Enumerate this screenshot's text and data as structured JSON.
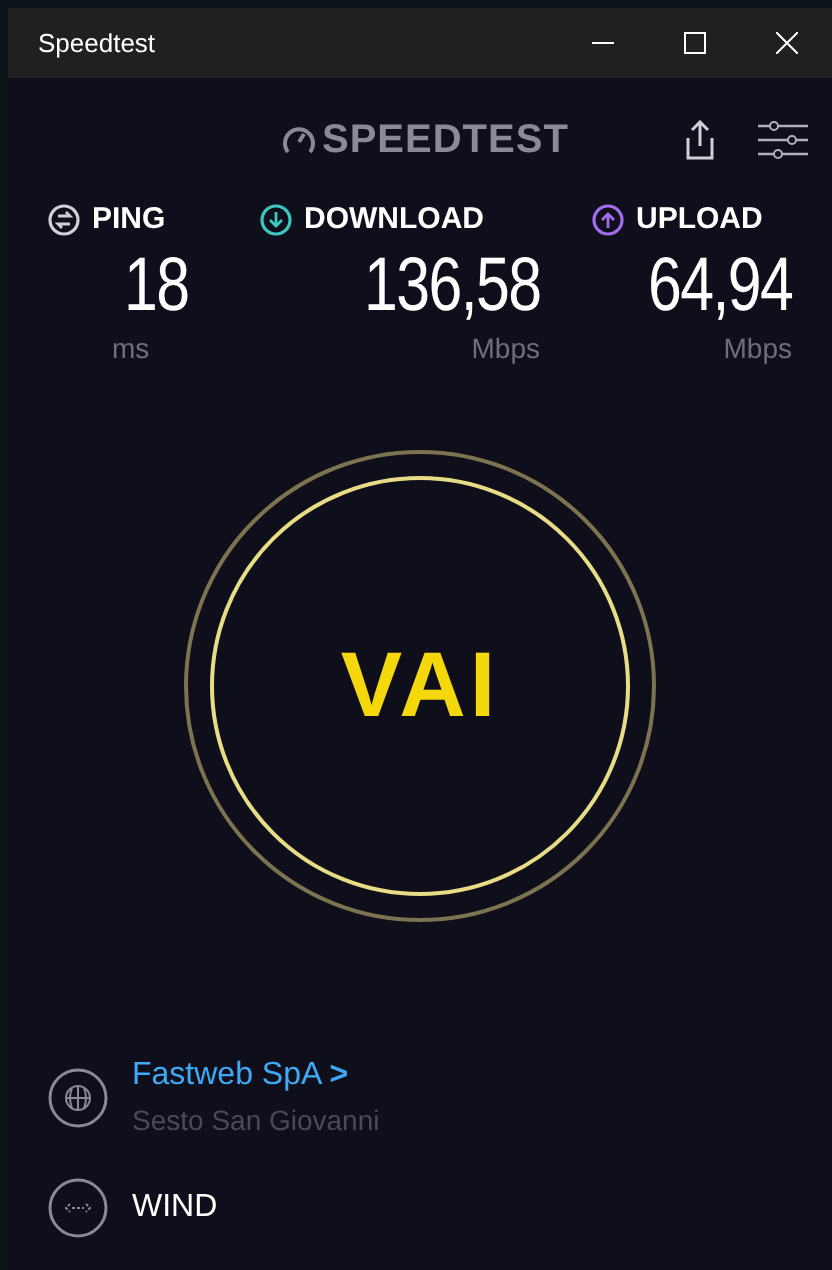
{
  "window": {
    "title": "Speedtest"
  },
  "logo": {
    "text": "SPEEDTEST"
  },
  "metrics": [
    {
      "kind": "ping",
      "label": "PING",
      "value": "18",
      "unit": "ms"
    },
    {
      "kind": "download",
      "label": "DOWNLOAD",
      "value": "136,58",
      "unit": "Mbps"
    },
    {
      "kind": "upload",
      "label": "UPLOAD",
      "value": "64,94",
      "unit": "Mbps"
    }
  ],
  "go_button": {
    "label": "VAI"
  },
  "server": {
    "name": "Fastweb SpA",
    "chevron": ">",
    "location": "Sesto San Giovanni"
  },
  "connection": {
    "name": "WIND"
  }
}
